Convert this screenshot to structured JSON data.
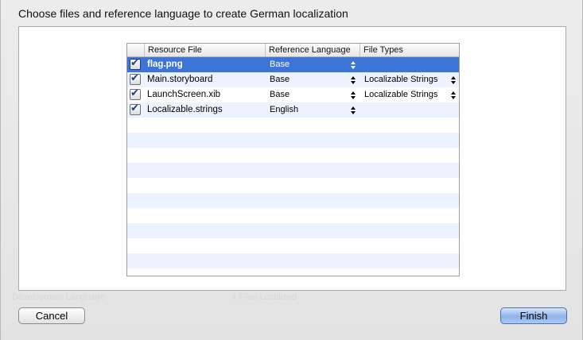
{
  "dialog": {
    "title": "Choose files and reference language to create German localization",
    "cancel_label": "Cancel",
    "finish_label": "Finish"
  },
  "table": {
    "headers": {
      "resource_file": "Resource File",
      "reference_language": "Reference Language",
      "file_types": "File Types"
    },
    "rows": [
      {
        "checked": true,
        "file": "flag.png",
        "language": "Base",
        "file_type": "",
        "selected": true
      },
      {
        "checked": true,
        "file": "Main.storyboard",
        "language": "Base",
        "file_type": "Localizable Strings",
        "selected": false
      },
      {
        "checked": true,
        "file": "LaunchScreen.xib",
        "language": "Base",
        "file_type": "Localizable Strings",
        "selected": false
      },
      {
        "checked": true,
        "file": "Localizable.strings",
        "language": "English",
        "file_type": "",
        "selected": false
      }
    ],
    "empty_rows": 11
  },
  "background": {
    "ghost_left": "Development Language",
    "ghost_right": "4 Files Localized"
  },
  "colors": {
    "selection": "#3d74d7",
    "stripe": "#edf3fe",
    "finish_button": "#8fb3ea"
  },
  "icons": {
    "checkbox": "checkmark-icon",
    "popup_arrows": "up-down-arrows-icon"
  }
}
